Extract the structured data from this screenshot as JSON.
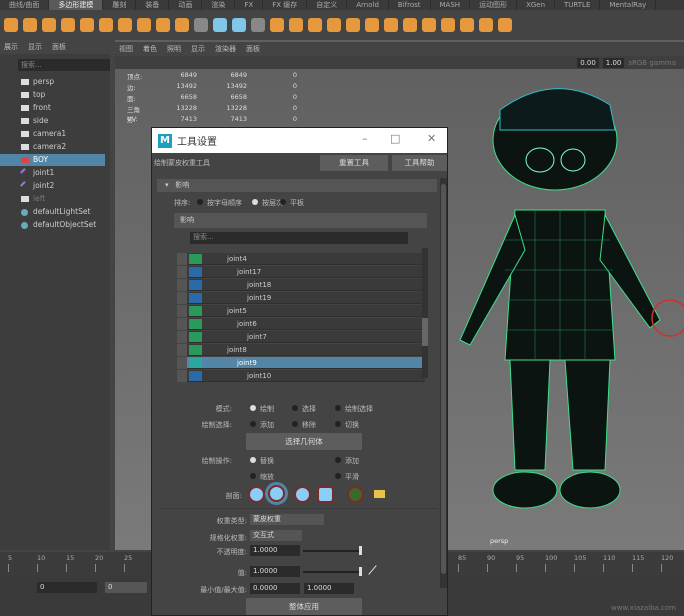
{
  "shelf_tabs": [
    "曲线/曲面",
    "多边形建模",
    "雕刻",
    "装备",
    "动画",
    "渲染",
    "FX",
    "FX 缓存",
    "自定义",
    "Arnold",
    "Bifrost",
    "MASH",
    "运动图形",
    "XGen",
    "TURTLE",
    "MentalRay"
  ],
  "shelf_active": 1,
  "outliner": {
    "menu": [
      "展示",
      "显示",
      "面板"
    ],
    "search_placeholder": "搜索...",
    "items": [
      {
        "label": "persp",
        "icon": "camera-icon"
      },
      {
        "label": "top",
        "icon": "camera-icon"
      },
      {
        "label": "front",
        "icon": "camera-icon"
      },
      {
        "label": "side",
        "icon": "camera-icon"
      },
      {
        "label": "camera1",
        "icon": "camera-icon"
      },
      {
        "label": "camera2",
        "icon": "camera-icon"
      },
      {
        "label": "BOY",
        "icon": "mesh-icon",
        "selected": true
      },
      {
        "label": "joint1",
        "icon": "joint-icon"
      },
      {
        "label": "joint2",
        "icon": "joint-icon"
      },
      {
        "label": "left",
        "icon": "camera-icon"
      },
      {
        "label": "defaultLightSet",
        "icon": "set-icon"
      },
      {
        "label": "defaultObjectSet",
        "icon": "set-icon"
      }
    ]
  },
  "viewport": {
    "menu": [
      "视图",
      "着色",
      "照明",
      "显示",
      "渲染器",
      "面板"
    ],
    "exposure": "0.00",
    "gamma": "1.00",
    "color_space": "sRGB gamma",
    "camera_label": "persp",
    "hud": [
      {
        "label": "顶点:",
        "a": "6849",
        "b": "6849",
        "c": "0"
      },
      {
        "label": "边:",
        "a": "13492",
        "b": "13492",
        "c": "0"
      },
      {
        "label": "面:",
        "a": "6658",
        "b": "6658",
        "c": "0"
      },
      {
        "label": "三角形:",
        "a": "13228",
        "b": "13228",
        "c": "0"
      },
      {
        "label": "UV:",
        "a": "7413",
        "b": "7413",
        "c": "0"
      }
    ]
  },
  "dialog": {
    "title": "工具设置",
    "tool_name": "绘制蒙皮权重工具",
    "reset_button": "重置工具",
    "help_button": "工具帮助",
    "section": "影响",
    "sort_label": "排序:",
    "sort_options": [
      "按字母顺序",
      "按层次",
      "平板"
    ],
    "sort_selected": 1,
    "influence_header": "影响",
    "search_placeholder": "搜索...",
    "joints": [
      {
        "label": "joint4",
        "indent": 1,
        "color": "#2a9a5a"
      },
      {
        "label": "joint17",
        "indent": 2,
        "color": "#2a6aa8"
      },
      {
        "label": "joint18",
        "indent": 3,
        "color": "#2a6aa8"
      },
      {
        "label": "joint19",
        "indent": 3,
        "color": "#2a6aa8"
      },
      {
        "label": "joint5",
        "indent": 1,
        "color": "#2a9a5a"
      },
      {
        "label": "joint6",
        "indent": 2,
        "color": "#2a9a5a"
      },
      {
        "label": "joint7",
        "indent": 3,
        "color": "#2a9a5a"
      },
      {
        "label": "joint8",
        "indent": 1,
        "color": "#2a9a5a"
      },
      {
        "label": "joint9",
        "indent": 2,
        "color": "#2aa8a0",
        "selected": true
      },
      {
        "label": "joint10",
        "indent": 3,
        "color": "#2a6aa8"
      }
    ],
    "mode_label": "模式:",
    "mode_options": [
      "绘制",
      "选择",
      "绘制选择"
    ],
    "paint_select_label": "绘制选择:",
    "paint_select_options": [
      "添加",
      "移除",
      "切换"
    ],
    "select_geometry_button": "选择几何体",
    "paint_op_label": "绘制操作:",
    "paint_op_options": [
      "替换",
      "添加",
      "缩放",
      "平滑"
    ],
    "profile_label": "剖面:",
    "weight_type_label": "权重类型:",
    "weight_type_value": "蒙皮权重",
    "normalize_label": "规格化权重:",
    "normalize_value": "交互式",
    "opacity_label": "不透明度:",
    "opacity_value": "1.0000",
    "opacity_fraction": 1.0,
    "value_label": "值:",
    "value_value": "1.0000",
    "value_fraction": 1.0,
    "minmax_label": "最小值/最大值:",
    "min_value": "0.0000",
    "max_value": "1.0000",
    "flood_button": "整体应用"
  },
  "timeline": {
    "ticks_left": [
      "5",
      "10",
      "15",
      "20",
      "25"
    ],
    "ticks_right": [
      "85",
      "90",
      "95",
      "100",
      "105",
      "110",
      "115",
      "120"
    ],
    "field1": "0",
    "field2": "0"
  },
  "watermark": "www.xiazaiba.com"
}
